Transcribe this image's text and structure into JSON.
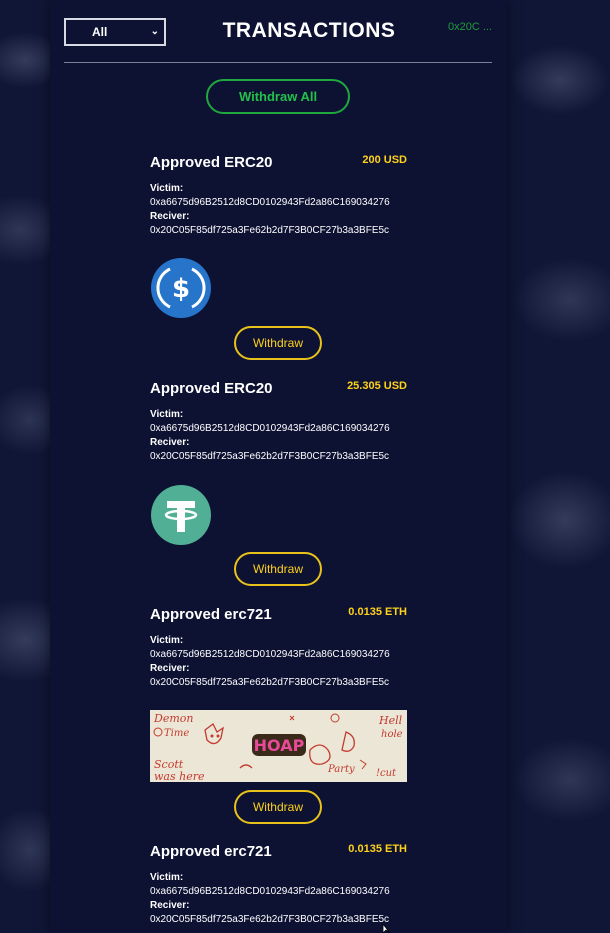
{
  "header": {
    "filter_value": "All",
    "title": "TRANSACTIONS",
    "account": "0x20C ..."
  },
  "withdraw_all_label": "Withdraw All",
  "labels": {
    "victim": "Victim:",
    "receiver": "Reciver:",
    "withdraw": "Withdraw"
  },
  "transactions": [
    {
      "name": "Approved ERC20",
      "amount": "200 USD",
      "victim": "0xa6675d96B2512d8CD0102943Fd2a86C169034276",
      "receiver": "0x20C05F85df725a3Fe62b2d7F3B0CF27b3a3BFE5c",
      "asset_icon": "usdc-icon"
    },
    {
      "name": "Approved ERC20",
      "amount": "25.305 USD",
      "victim": "0xa6675d96B2512d8CD0102943Fd2a86C169034276",
      "receiver": "0x20C05F85df725a3Fe62b2d7F3B0CF27b3a3BFE5c",
      "asset_icon": "tether-icon"
    },
    {
      "name": "Approved erc721",
      "amount": "0.0135 ETH",
      "victim": "0xa6675d96B2512d8CD0102943Fd2a86C169034276",
      "receiver": "0x20C05F85df725a3Fe62b2d7F3B0CF27b3a3BFE5c",
      "asset_icon": "nft-image",
      "nft_text": [
        "Demon",
        "Time",
        "Scott",
        "was here",
        "Party",
        "Hell",
        "hole",
        "!cut",
        "HOAP"
      ]
    },
    {
      "name": "Approved erc721",
      "amount": "0.0135 ETH",
      "victim": "0xa6675d96B2512d8CD0102943Fd2a86C169034276",
      "receiver": "0x20C05F85df725a3Fe62b2d7F3B0CF27b3a3BFE5c"
    }
  ],
  "colors": {
    "panel": "#0d1233",
    "accent_green": "#23c14a",
    "accent_yellow": "#ffd21a",
    "usdc_blue": "#2775ca",
    "tether_green": "#50af95"
  }
}
